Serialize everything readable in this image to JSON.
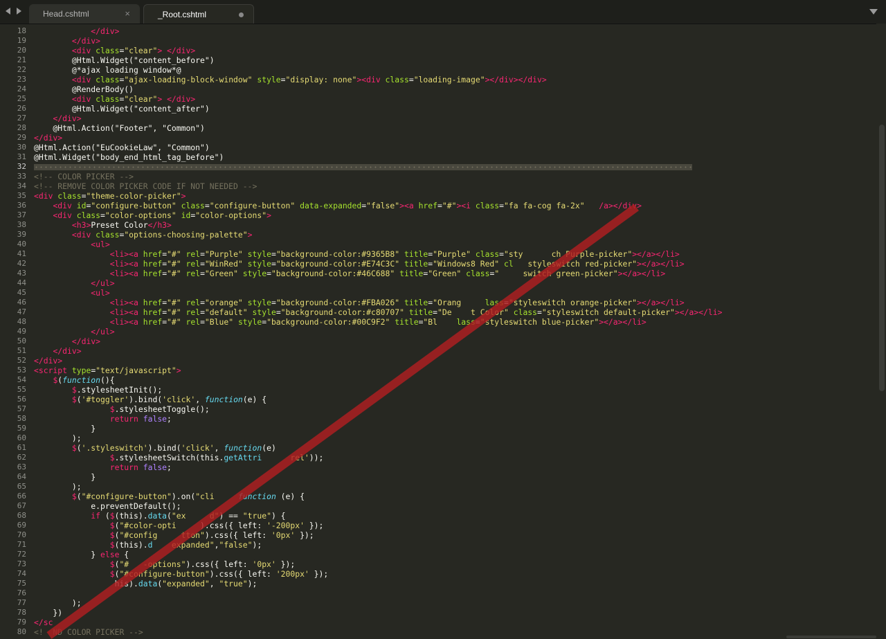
{
  "tabs": [
    {
      "label": "Head.cshtml",
      "close": "×"
    },
    {
      "label": "_Root.cshtml"
    }
  ],
  "editor": {
    "current_line": 32,
    "lines": [
      {
        "n": 18,
        "h": "            <span class=\"t\">&lt;/div&gt;</span>"
      },
      {
        "n": 19,
        "h": "        <span class=\"t\">&lt;/div&gt;</span>"
      },
      {
        "n": 20,
        "h": "        <span class=\"t\">&lt;div</span> <span class=\"a\">class</span>=<span class=\"s\">\"clear\"</span><span class=\"t\">&gt;</span> <span class=\"t\">&lt;/div&gt;</span>"
      },
      {
        "n": 21,
        "h": "        @Html.Widget(\"content_before\")"
      },
      {
        "n": 22,
        "h": "        @*ajax loading window*@"
      },
      {
        "n": 23,
        "h": "        <span class=\"t\">&lt;div</span> <span class=\"a\">class</span>=<span class=\"s\">\"ajax-loading-block-window\"</span> <span class=\"a\">style</span>=<span class=\"s\">\"display: none\"</span><span class=\"t\">&gt;&lt;div</span> <span class=\"a\">class</span>=<span class=\"s\">\"loading-image\"</span><span class=\"t\">&gt;&lt;/div&gt;&lt;/div&gt;</span>"
      },
      {
        "n": 24,
        "h": "        @RenderBody()"
      },
      {
        "n": 25,
        "h": "        <span class=\"t\">&lt;div</span> <span class=\"a\">class</span>=<span class=\"s\">\"clear\"</span><span class=\"t\">&gt;</span> <span class=\"t\">&lt;/div&gt;</span>"
      },
      {
        "n": 26,
        "h": "        @Html.Widget(\"content_after\")"
      },
      {
        "n": 27,
        "h": "    <span class=\"t\">&lt;/div&gt;</span>"
      },
      {
        "n": 28,
        "h": "    @Html.Action(\"Footer\", \"Common\")"
      },
      {
        "n": 29,
        "h": "<span class=\"t\">&lt;/div&gt;</span>"
      },
      {
        "n": 30,
        "h": "@Html.Action(\"EuCookieLaw\", \"Common\")"
      },
      {
        "n": 31,
        "h": "@Html.Widget(\"body_end_html_tag_before\")"
      },
      {
        "n": 32,
        "h": "<span class=\"wsdots\"></span>"
      },
      {
        "n": 33,
        "h": "<span class=\"c\">&lt;!-- COLOR PICKER --&gt;</span>"
      },
      {
        "n": 34,
        "h": "<span class=\"c\">&lt;!-- REMOVE COLOR PICKER CODE IF NOT NEEDED --&gt;</span>"
      },
      {
        "n": 35,
        "h": "<span class=\"t\">&lt;div</span> <span class=\"a\">class</span>=<span class=\"s\">\"theme-color-picker\"</span><span class=\"t\">&gt;</span>"
      },
      {
        "n": 36,
        "h": "    <span class=\"t\">&lt;div</span> <span class=\"a\">id</span>=<span class=\"s\">\"configure-button\"</span> <span class=\"a\">class</span>=<span class=\"s\">\"configure-button\"</span> <span class=\"a\">data-expanded</span>=<span class=\"s\">\"false\"</span><span class=\"t\">&gt;&lt;a</span> <span class=\"a\">href</span>=<span class=\"s\">\"#\"</span><span class=\"t\">&gt;&lt;i</span> <span class=\"a\">class</span>=<span class=\"s\">\"fa fa-cog fa-2x\"</span>   <span class=\"t\">/a&gt;&lt;/div&gt;</span>"
      },
      {
        "n": 37,
        "h": "    <span class=\"t\">&lt;div</span> <span class=\"a\">class</span>=<span class=\"s\">\"color-options\"</span> <span class=\"a\">id</span>=<span class=\"s\">\"color-options\"</span><span class=\"t\">&gt;</span>"
      },
      {
        "n": 38,
        "h": "        <span class=\"t\">&lt;h3&gt;</span>Preset Color<span class=\"t\">&lt;/h3&gt;</span>"
      },
      {
        "n": 39,
        "h": "        <span class=\"t\">&lt;div</span> <span class=\"a\">class</span>=<span class=\"s\">\"options-choosing-palette\"</span><span class=\"t\">&gt;</span>"
      },
      {
        "n": 40,
        "h": "            <span class=\"t\">&lt;ul&gt;</span>"
      },
      {
        "n": 41,
        "h": "                <span class=\"t\">&lt;li&gt;&lt;a</span> <span class=\"a\">href</span>=<span class=\"s\">\"#\"</span> <span class=\"a\">rel</span>=<span class=\"s\">\"Purple\"</span> <span class=\"a\">style</span>=<span class=\"s\">\"background-color:#9365B8\"</span> <span class=\"a\">title</span>=<span class=\"s\">\"Purple\"</span> <span class=\"a\">class</span>=<span class=\"s\">\"sty      ch Purple-picker\"</span><span class=\"t\">&gt;&lt;/a&gt;&lt;/li&gt;</span>"
      },
      {
        "n": 42,
        "h": "                <span class=\"t\">&lt;li&gt;&lt;a</span> <span class=\"a\">href</span>=<span class=\"s\">\"#\"</span> <span class=\"a\">rel</span>=<span class=\"s\">\"WinRed\"</span> <span class=\"a\">style</span>=<span class=\"s\">\"background-color:#E74C3C\"</span> <span class=\"a\">title</span>=<span class=\"s\">\"Windows8 Red\"</span> <span class=\"a\">cl</span>   <span class=\"s\">styleswitch red-picker\"</span><span class=\"t\">&gt;&lt;/a&gt;&lt;/li&gt;</span>"
      },
      {
        "n": 43,
        "h": "                <span class=\"t\">&lt;li&gt;&lt;a</span> <span class=\"a\">href</span>=<span class=\"s\">\"#\"</span> <span class=\"a\">rel</span>=<span class=\"s\">\"Green\"</span> <span class=\"a\">style</span>=<span class=\"s\">\"background-color:#46C688\"</span> <span class=\"a\">title</span>=<span class=\"s\">\"Green\"</span> <span class=\"a\">class</span>=<span class=\"s\">\"     switch green-picker\"</span><span class=\"t\">&gt;&lt;/a&gt;&lt;/li&gt;</span>"
      },
      {
        "n": 44,
        "h": "            <span class=\"t\">&lt;/ul&gt;</span>"
      },
      {
        "n": 45,
        "h": "            <span class=\"t\">&lt;ul&gt;</span>"
      },
      {
        "n": 46,
        "h": "                <span class=\"t\">&lt;li&gt;&lt;a</span> <span class=\"a\">href</span>=<span class=\"s\">\"#\"</span> <span class=\"a\">rel</span>=<span class=\"s\">\"orange\"</span> <span class=\"a\">style</span>=<span class=\"s\">\"background-color:#FBA026\"</span> <span class=\"a\">title</span>=<span class=\"s\">\"Orang     </span><span class=\"a\">lass</span>=<span class=\"s\">\"styleswitch orange-picker\"</span><span class=\"t\">&gt;&lt;/a&gt;&lt;/li&gt;</span>"
      },
      {
        "n": 47,
        "h": "                <span class=\"t\">&lt;li&gt;&lt;a</span> <span class=\"a\">href</span>=<span class=\"s\">\"#\"</span> <span class=\"a\">rel</span>=<span class=\"s\">\"default\"</span> <span class=\"a\">style</span>=<span class=\"s\">\"background-color:#c80707\"</span> <span class=\"a\">title</span>=<span class=\"s\">\"De    t Color\"</span> <span class=\"a\">class</span>=<span class=\"s\">\"styleswitch default-picker\"</span><span class=\"t\">&gt;&lt;/a&gt;&lt;/li&gt;</span>"
      },
      {
        "n": 48,
        "h": "                <span class=\"t\">&lt;li&gt;&lt;a</span> <span class=\"a\">href</span>=<span class=\"s\">\"#\"</span> <span class=\"a\">rel</span>=<span class=\"s\">\"Blue\"</span> <span class=\"a\">style</span>=<span class=\"s\">\"background-color:#00C9F2\"</span> <span class=\"a\">title</span>=<span class=\"s\">\"Bl    </span><span class=\"a\">lass</span>=<span class=\"s\">\"styleswitch blue-picker\"</span><span class=\"t\">&gt;&lt;/a&gt;&lt;/li&gt;</span>"
      },
      {
        "n": 49,
        "h": "            <span class=\"t\">&lt;/ul&gt;</span>"
      },
      {
        "n": 50,
        "h": "        <span class=\"t\">&lt;/div&gt;</span>"
      },
      {
        "n": 51,
        "h": "    <span class=\"t\">&lt;/div&gt;</span>"
      },
      {
        "n": 52,
        "h": "<span class=\"t\">&lt;/div&gt;</span>"
      },
      {
        "n": 53,
        "h": "<span class=\"t\">&lt;script</span> <span class=\"a\">type</span>=<span class=\"s\">\"text/javascript\"</span><span class=\"t\">&gt;</span>"
      },
      {
        "n": 54,
        "h": "    <span class=\"d\">$</span>(<span class=\"k\">function</span>(){"
      },
      {
        "n": 55,
        "h": "        <span class=\"d\">$</span>.stylesheetInit();"
      },
      {
        "n": 56,
        "h": "        <span class=\"d\">$</span>(<span class=\"s\">'#toggler'</span>).bind(<span class=\"s\">'click'</span>, <span class=\"k\">function</span>(e) {"
      },
      {
        "n": 57,
        "h": "                <span class=\"d\">$</span>.stylesheetToggle();"
      },
      {
        "n": 58,
        "h": "                <span class=\"r\">return</span> <span class=\"p\">false</span>;"
      },
      {
        "n": 59,
        "h": "            }"
      },
      {
        "n": 60,
        "h": "        );"
      },
      {
        "n": 61,
        "h": "        <span class=\"d\">$</span>(<span class=\"s\">'.styleswitch'</span>).bind(<span class=\"s\">'click'</span>, <span class=\"k\">function</span>(e)"
      },
      {
        "n": 62,
        "h": "                <span class=\"d\">$</span>.stylesheetSwitch(this.<span class=\"m\">getAttri</span>      <span class=\"s\">rel'</span>));"
      },
      {
        "n": 63,
        "h": "                <span class=\"r\">return</span> <span class=\"p\">false</span>;"
      },
      {
        "n": 64,
        "h": "            }"
      },
      {
        "n": 65,
        "h": "        );"
      },
      {
        "n": 66,
        "h": "        <span class=\"d\">$</span>(<span class=\"s\">\"#configure-button\"</span>).on(<span class=\"s\">\"cli     </span><span class=\"k\">function</span> (e) {"
      },
      {
        "n": 67,
        "h": "            e.preventDefault();"
      },
      {
        "n": 68,
        "h": "            <span class=\"r\">if</span> (<span class=\"d\">$</span>(this).<span class=\"m\">data</span>(<span class=\"s\">\"ex     d\"</span>) == <span class=\"s\">\"true\"</span>) {"
      },
      {
        "n": 69,
        "h": "                <span class=\"d\">$</span>(<span class=\"s\">\"#color-opti     </span>).css({ left: <span class=\"s\">'-200px'</span> });"
      },
      {
        "n": 70,
        "h": "                <span class=\"d\">$</span>(<span class=\"s\">\"#config     tton\"</span>).css({ left: <span class=\"s\">'0px'</span> });"
      },
      {
        "n": 71,
        "h": "                <span class=\"d\">$</span>(this).<span class=\"m\">d   </span> <span class=\"s\">expanded\"</span>,<span class=\"s\">\"false\"</span>);"
      },
      {
        "n": 72,
        "h": "            } <span class=\"r\">else</span> {"
      },
      {
        "n": 73,
        "h": "                <span class=\"d\">$</span>(<span class=\"s\">\"#   -options\"</span>).css({ left: <span class=\"s\">'0px'</span> });"
      },
      {
        "n": 74,
        "h": "                <span class=\"d\">$</span>(<span class=\"s\">\"#configure-button\"</span>).css({ left: <span class=\"s\">'200px'</span> });"
      },
      {
        "n": 75,
        "h": "                 his).<span class=\"m\">data</span>(<span class=\"s\">\"expanded\"</span>, <span class=\"s\">\"true\"</span>);"
      },
      {
        "n": 76,
        "h": ""
      },
      {
        "n": 77,
        "h": "        );"
      },
      {
        "n": 78,
        "h": "    })"
      },
      {
        "n": 79,
        "h": "<span class=\"t\">&lt;/sc</span>"
      },
      {
        "n": 80,
        "h": "<span class=\"c\">&lt;!  ND COLOR PICKER --&gt;</span>"
      }
    ]
  }
}
